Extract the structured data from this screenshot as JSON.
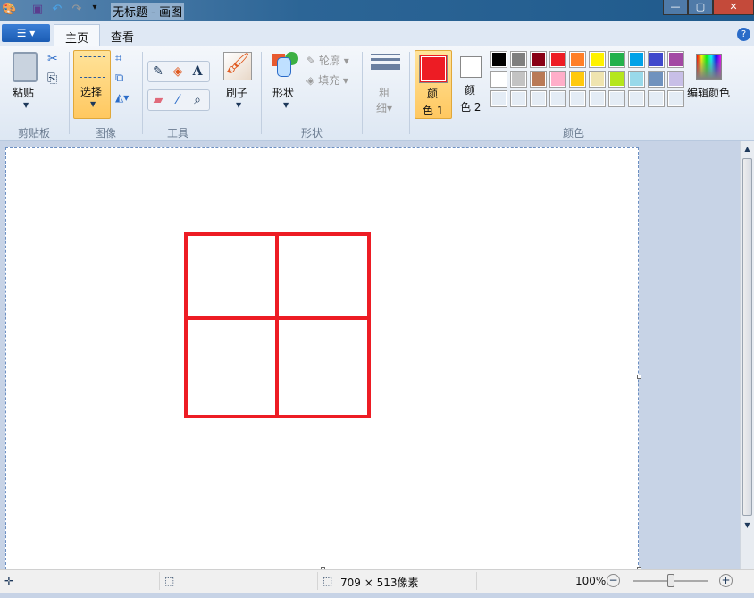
{
  "window": {
    "title": "无标题 - 画图"
  },
  "tabs": [
    {
      "label": "主页",
      "active": true
    },
    {
      "label": "查看",
      "active": false
    }
  ],
  "clipboard": {
    "paste": "粘贴",
    "group": "剪贴板"
  },
  "image": {
    "select": "选择",
    "group": "图像"
  },
  "tools": {
    "group": "工具"
  },
  "brush": {
    "label": "刷子"
  },
  "shapes": {
    "label": "形状",
    "outline": "轮廓",
    "fill": "填充",
    "group": "形状"
  },
  "size": {
    "label1": "粗",
    "label2": "细"
  },
  "colors": {
    "color1_a": "颜",
    "color1_b": "色 1",
    "color2_a": "颜",
    "color2_b": "色 2",
    "edit": "编辑颜色",
    "group": "颜色",
    "color1": "#ed1c24",
    "color2": "#ffffff",
    "palette_row1": [
      "#000000",
      "#7f7f7f",
      "#880015",
      "#ed1c24",
      "#ff7f27",
      "#fff200",
      "#22b14c",
      "#00a2e8",
      "#3f48cc",
      "#a349a4"
    ],
    "palette_row2": [
      "#ffffff",
      "#c3c3c3",
      "#b97a57",
      "#ffaec9",
      "#ffc90e",
      "#efe4b0",
      "#b5e61d",
      "#99d9ea",
      "#7092be",
      "#c8bfe7"
    ]
  },
  "drawing": {
    "stroke_color": "#ed1c24"
  },
  "status": {
    "size": "709 × 513像素",
    "zoom": "100%",
    "zoom_level_percent": 100
  }
}
